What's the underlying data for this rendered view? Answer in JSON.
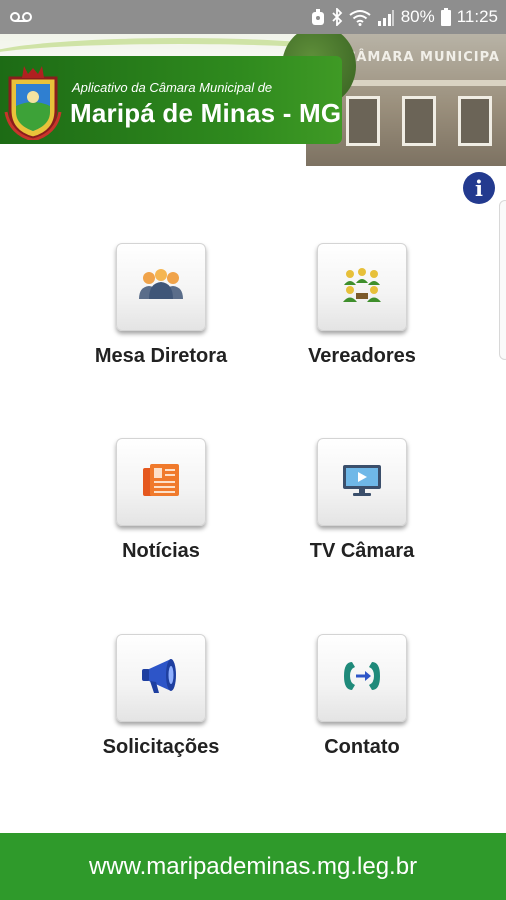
{
  "status_bar": {
    "battery": "80%",
    "time": "11:25",
    "icons": [
      "voicemail-icon",
      "alarm-icon",
      "bluetooth-icon",
      "wifi-icon",
      "signal-icon",
      "battery-icon"
    ]
  },
  "banner": {
    "subtitle": "Aplicativo da Câmara Municipal de",
    "title": "Maripá de Minas - MG",
    "building_sign": "CÂMARA MUNICIPA",
    "colors": {
      "green": "#2f8a1e",
      "light_green": "#cfe3a6"
    }
  },
  "info_button": {
    "label": "i",
    "color": "#233a8f"
  },
  "menu": {
    "items": [
      {
        "label": "Mesa Diretora",
        "icon": "group-people-icon"
      },
      {
        "label": "Vereadores",
        "icon": "councilors-icon"
      },
      {
        "label": "Notícias",
        "icon": "newspaper-icon"
      },
      {
        "label": "TV Câmara",
        "icon": "tv-play-icon"
      },
      {
        "label": "Solicitações",
        "icon": "megaphone-icon"
      },
      {
        "label": "Contato",
        "icon": "phone-contact-icon"
      }
    ]
  },
  "footer": {
    "url": "www.maripademinas.mg.leg.br",
    "color": "#2f9a2b"
  }
}
